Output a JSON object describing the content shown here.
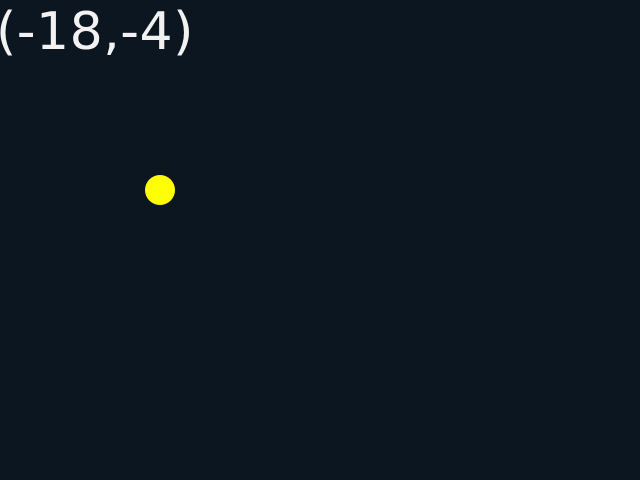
{
  "readout": {
    "coordinates": "(-18,-4)"
  },
  "marker": {
    "color": "#ffff00"
  },
  "theme": {
    "background": "#0c1620",
    "text": "#f2f2f2"
  }
}
